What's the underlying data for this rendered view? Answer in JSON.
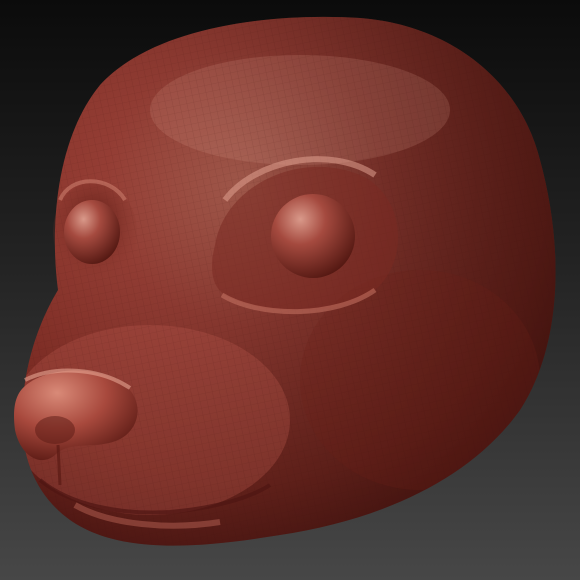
{
  "scene": {
    "subject": "sculpted-creature-head",
    "material_color": "#9a3a2d",
    "material_highlight": "#d98a78",
    "material_shadow": "#4a1410",
    "background_top": "#0b0b0b",
    "background_bottom": "#474747",
    "wireframe_visible": true
  }
}
